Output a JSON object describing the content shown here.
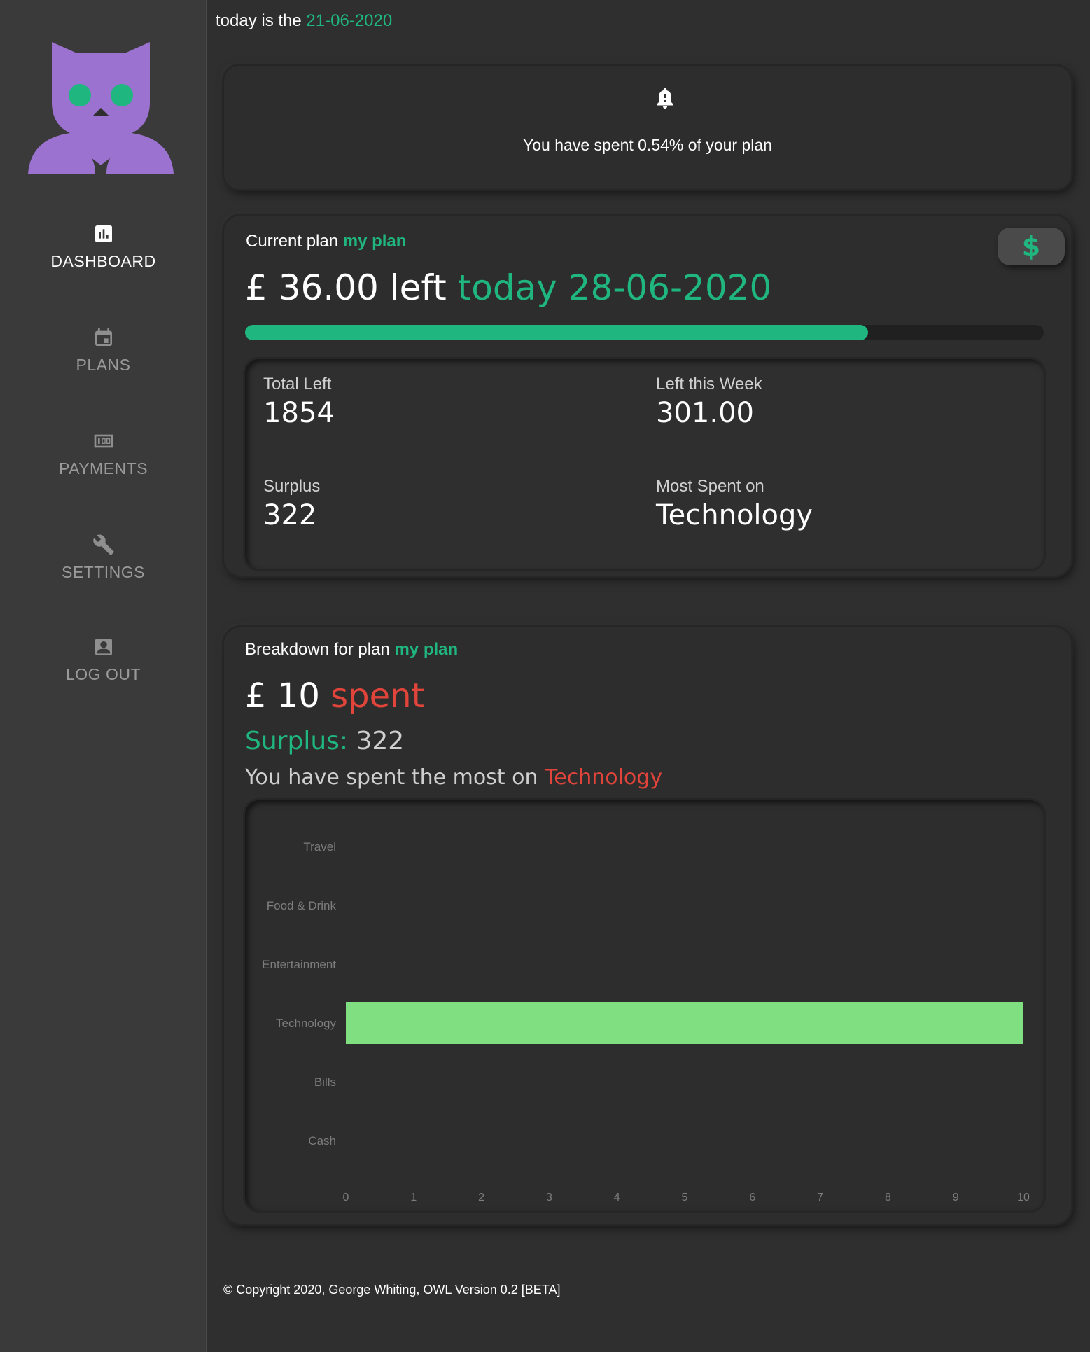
{
  "header": {
    "date_prefix": "today is the",
    "date": "21-06-2020"
  },
  "sidebar": {
    "items": [
      {
        "label": "DASHBOARD",
        "icon": "bar-chart-icon",
        "active": true
      },
      {
        "label": "PLANS",
        "icon": "calendar-icon",
        "active": false
      },
      {
        "label": "PAYMENTS",
        "icon": "money-icon",
        "active": false
      },
      {
        "label": "SETTINGS",
        "icon": "wrench-icon",
        "active": false
      },
      {
        "label": "LOG OUT",
        "icon": "account-box-icon",
        "active": false
      }
    ]
  },
  "alert": {
    "icon": "bell-alert-icon",
    "message": "You have spent 0.54% of your plan"
  },
  "current_plan": {
    "title_prefix": "Current plan",
    "plan_name": "my plan",
    "button_icon": "$",
    "amount": "£ 36.00 left",
    "today_label": "today",
    "today_date": "28-06-2020",
    "progress_percent": 78,
    "stats": {
      "total_left_label": "Total Left",
      "total_left_value": "1854",
      "left_week_label": "Left this Week",
      "left_week_value": "301.00",
      "surplus_label": "Surplus",
      "surplus_value": "322",
      "most_spent_label": "Most Spent on",
      "most_spent_value": "Technology"
    }
  },
  "breakdown": {
    "title_prefix": "Breakdown for plan",
    "plan_name": "my plan",
    "spent_amount": "£ 10",
    "spent_word": "spent",
    "surplus_label": "Surplus:",
    "surplus_value": "322",
    "most_prefix": "You have spent the most on",
    "most_category": "Technology"
  },
  "chart_data": {
    "type": "bar",
    "orientation": "horizontal",
    "categories": [
      "Travel",
      "Food & Drink",
      "Entertainment",
      "Technology",
      "Bills",
      "Cash"
    ],
    "values": [
      0,
      0,
      0,
      10,
      0,
      0
    ],
    "xlim": [
      0,
      10
    ],
    "xticks": [
      0,
      1,
      2,
      3,
      4,
      5,
      6,
      7,
      8,
      9,
      10
    ],
    "bar_color": "#80e081",
    "grid": false,
    "legend": false
  },
  "footer": {
    "text": "© Copyright 2020, George Whiting, OWL Version 0.2 [BETA]"
  },
  "colors": {
    "accent": "#20b67f",
    "danger": "#e0443a",
    "logo": "#9b72cf",
    "bar": "#80e081"
  }
}
